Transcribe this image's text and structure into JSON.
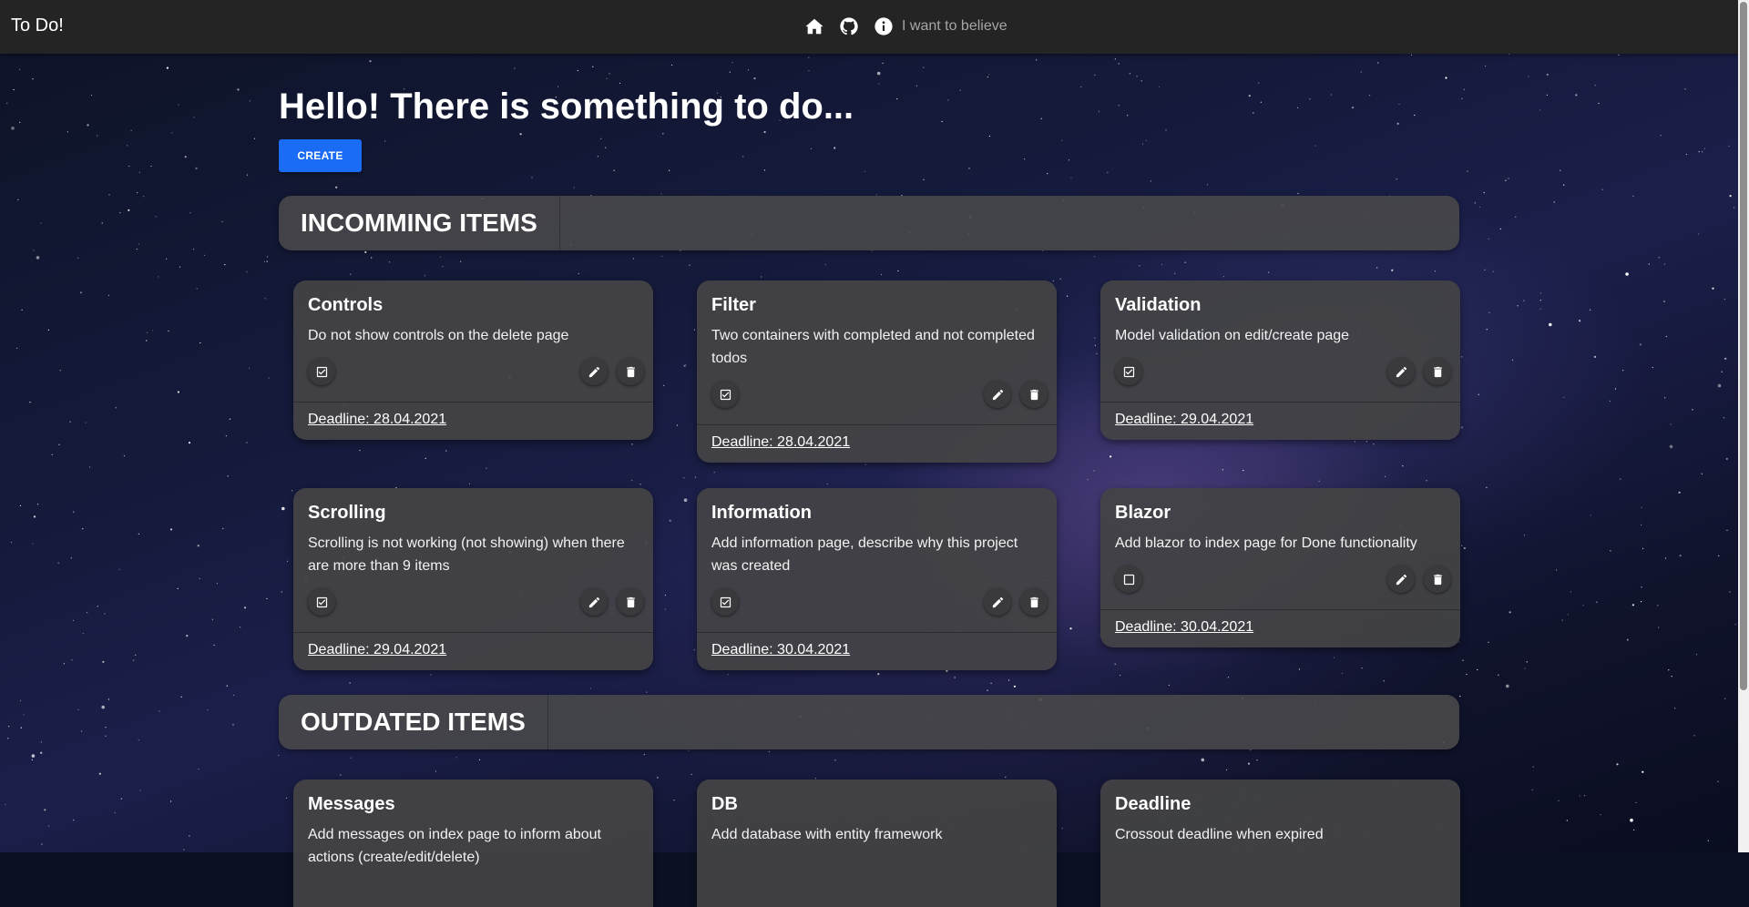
{
  "navbar": {
    "brand": "To Do!",
    "icons": [
      "home-icon",
      "github-icon",
      "info-icon"
    ],
    "believe_text": "I want to believe"
  },
  "main": {
    "title": "Hello! There is something to do...",
    "create_label": "CREATE"
  },
  "sections": [
    {
      "title": "INCOMMING ITEMS",
      "items": [
        {
          "title": "Controls",
          "description": "Do not show controls on the delete page",
          "deadline": "Deadline: 28.04.2021",
          "done": true
        },
        {
          "title": "Filter",
          "description": "Two containers with completed and not completed todos",
          "deadline": "Deadline: 28.04.2021",
          "done": true
        },
        {
          "title": "Validation",
          "description": "Model validation on edit/create page",
          "deadline": "Deadline: 29.04.2021",
          "done": true
        },
        {
          "title": "Scrolling",
          "description": "Scrolling is not working (not showing) when there are more than 9 items",
          "deadline": "Deadline: 29.04.2021",
          "done": true
        },
        {
          "title": "Information",
          "description": "Add information page, describe why this project was created",
          "deadline": "Deadline: 30.04.2021",
          "done": true
        },
        {
          "title": "Blazor",
          "description": "Add blazor to index page for Done functionality",
          "deadline": "Deadline: 30.04.2021",
          "done": false
        }
      ]
    },
    {
      "title": "OUTDATED ITEMS",
      "items": [
        {
          "title": "Messages",
          "description": "Add messages on index page to inform about actions (create/edit/delete)"
        },
        {
          "title": "DB",
          "description": "Add database with entity framework"
        },
        {
          "title": "Deadline",
          "description": "Crossout deadline when expired"
        }
      ]
    }
  ],
  "colors": {
    "navbar": "#242424",
    "accent": "#1a6cf5",
    "card": "#424246"
  }
}
